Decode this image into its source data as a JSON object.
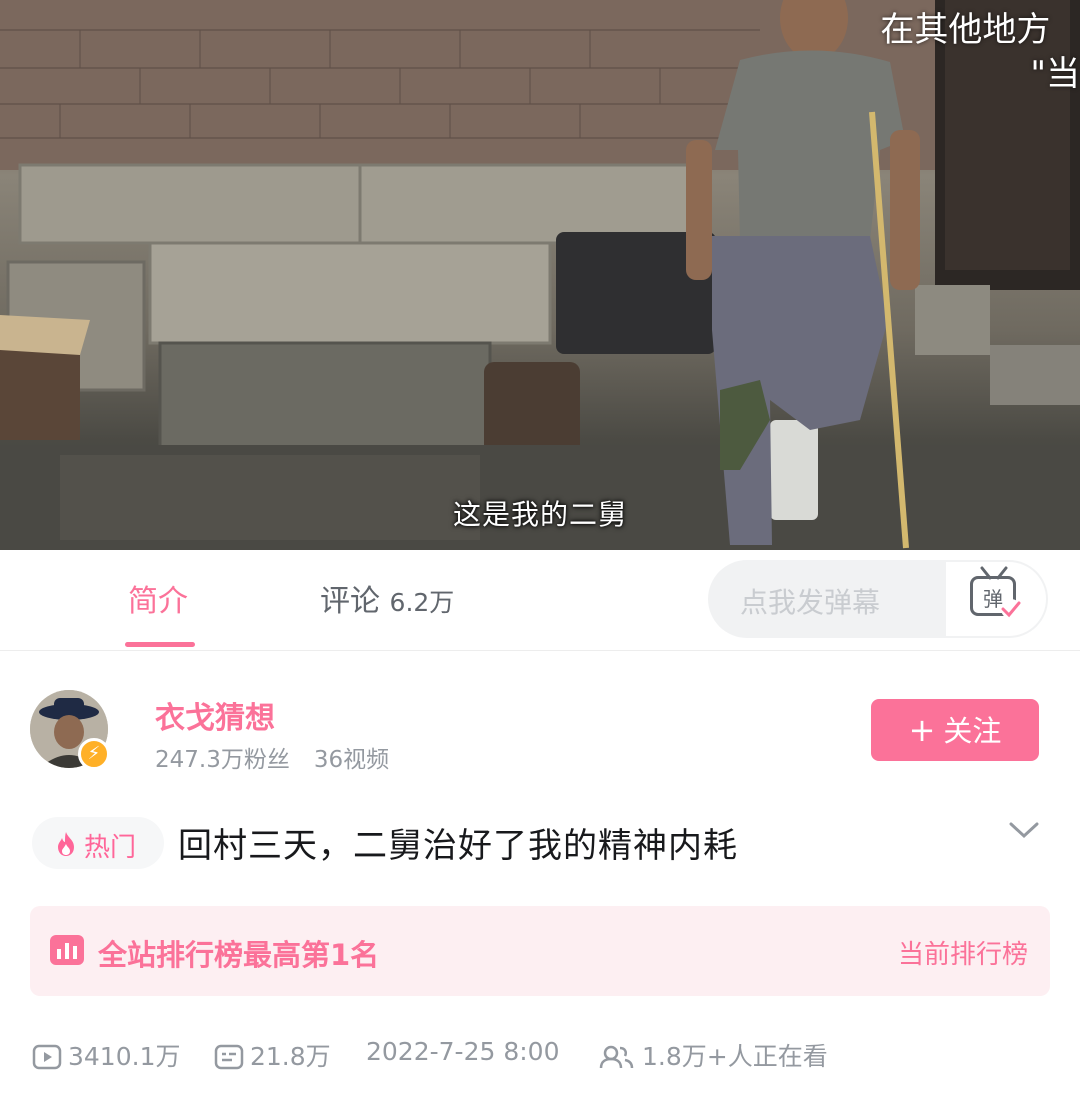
{
  "video": {
    "overlay_text_line1": "在其他地方",
    "overlay_text_line2": "\"当",
    "subtitle": "这是我的二舅"
  },
  "tabs": {
    "intro_label": "简介",
    "comments_label": "评论",
    "comments_count": "6.2万"
  },
  "danmaku": {
    "placeholder": "点我发弹幕",
    "button_glyph": "弹"
  },
  "uploader": {
    "name": "衣戈猜想",
    "followers": "247.3万粉丝",
    "videos": "36视频",
    "follow_label": "关注",
    "follow_plus": "+"
  },
  "title": {
    "hot_label": "热门",
    "text": "回村三天，二舅治好了我的精神内耗"
  },
  "rank": {
    "label": "全站排行榜最高第1名",
    "link": "当前排行榜"
  },
  "stats": {
    "views": "3410.1万",
    "danmaku_count": "21.8万",
    "date": "2022-7-25 8:00",
    "watching": "1.8万+人正在看"
  },
  "colors": {
    "accent": "#fb7299",
    "muted": "#9499a0",
    "rank_bg": "#fdeff2"
  },
  "icons": [
    "play-icon",
    "danmaku-list-icon",
    "people-icon",
    "flame-icon",
    "chart-bars-icon",
    "tv-danmaku-icon",
    "chevron-down-icon",
    "lightning-icon"
  ]
}
